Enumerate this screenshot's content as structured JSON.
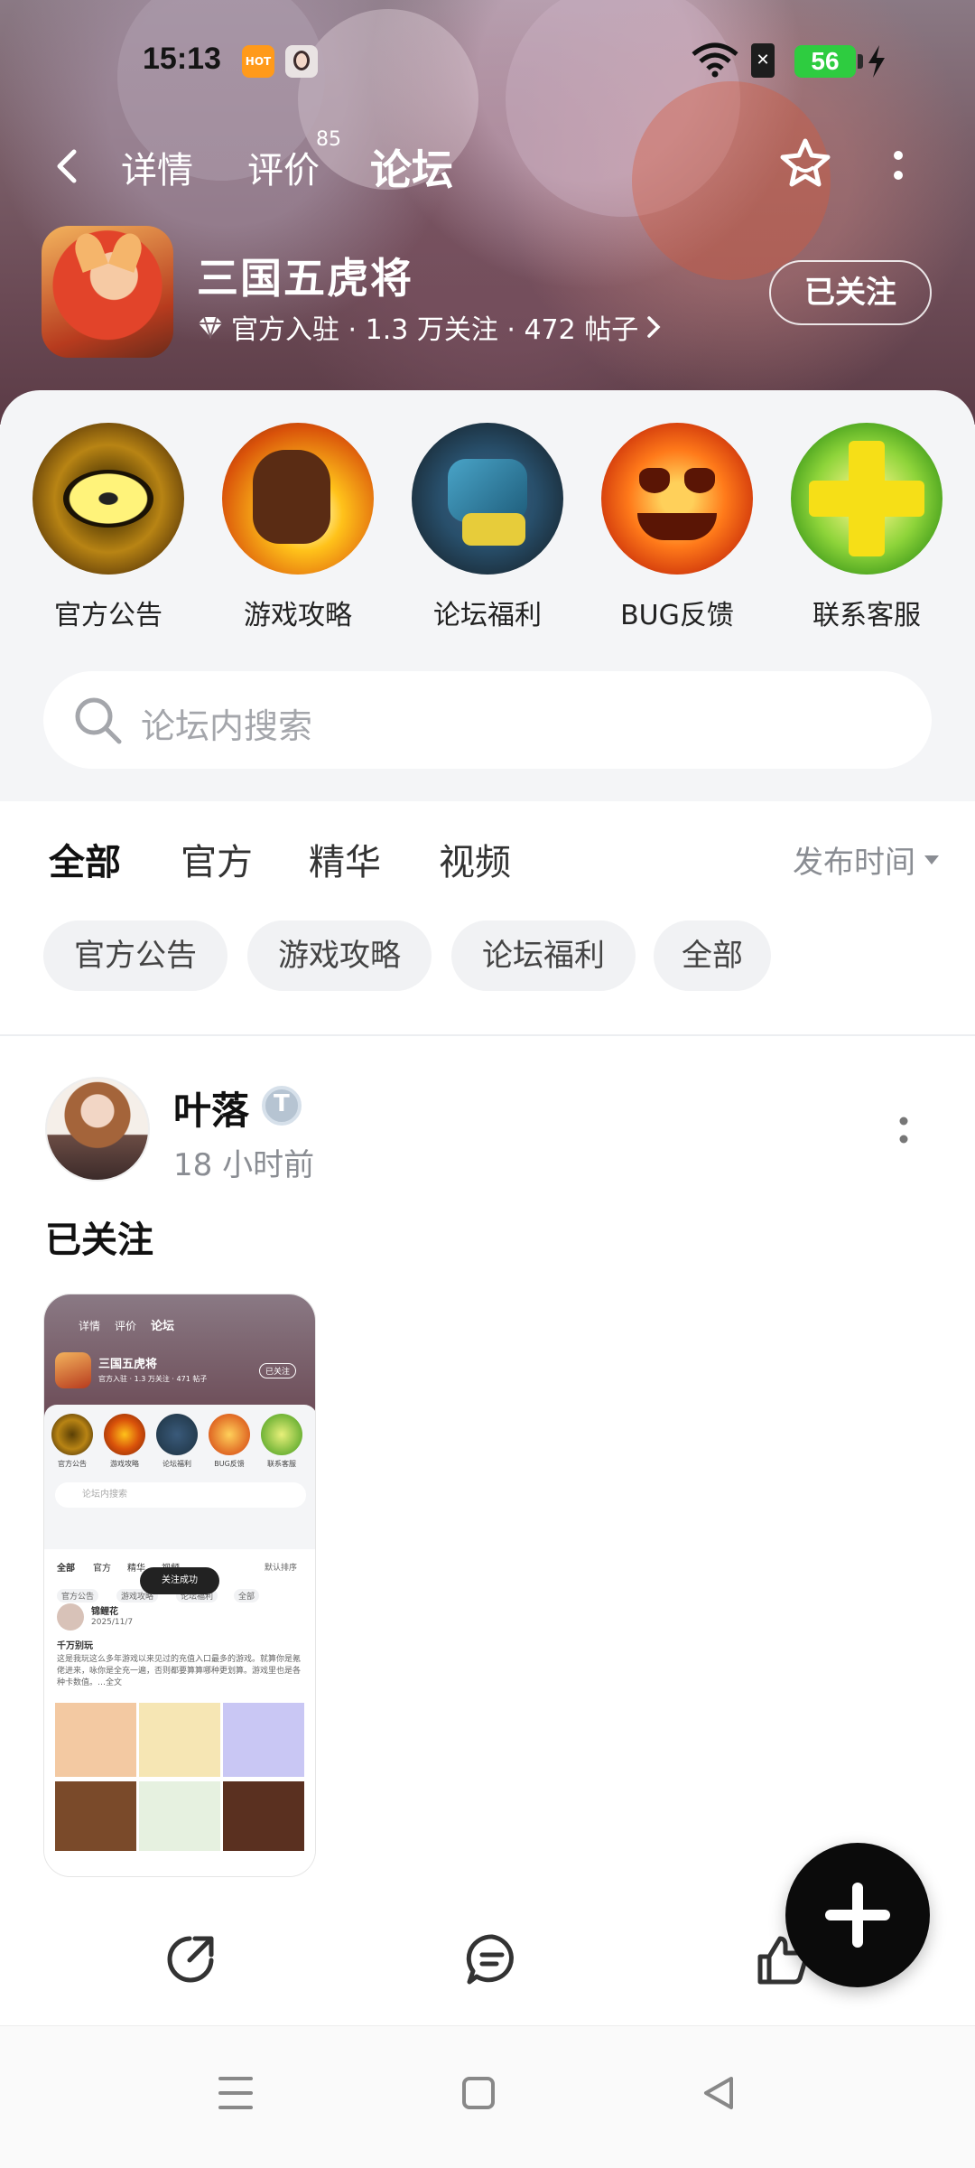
{
  "status_bar": {
    "time": "15:13",
    "app_badge": "HOT",
    "battery": "56",
    "accent_battery": "#2ecc40"
  },
  "nav": {
    "tabs": [
      {
        "label": "详情"
      },
      {
        "label": "评价",
        "badge": "85"
      },
      {
        "label": "论坛",
        "active": true
      }
    ],
    "icons": [
      "back-icon",
      "star-icon",
      "more-icon"
    ]
  },
  "game": {
    "name": "三国五虎将",
    "meta": "官方入驻 · 1.3 万关注 · 472 帖子",
    "follow_label": "已关注"
  },
  "categories": [
    {
      "label": "官方公告"
    },
    {
      "label": "游戏攻略"
    },
    {
      "label": "论坛福利"
    },
    {
      "label": "BUG反馈"
    },
    {
      "label": "联系客服"
    }
  ],
  "search": {
    "placeholder": "论坛内搜索"
  },
  "filter_tabs": {
    "items": [
      "全部",
      "官方",
      "精华",
      "视频"
    ],
    "active": "全部",
    "sort_label": "发布时间",
    "accent": "#19d7c2"
  },
  "chips": [
    "官方公告",
    "游戏攻略",
    "论坛福利",
    "全部"
  ],
  "post": {
    "author": "叶落",
    "time": "18 小时前",
    "title": "已关注",
    "image_text": {
      "tabs": [
        "详情",
        "评价",
        "论坛"
      ],
      "game_name": "三国五虎将",
      "meta": "官方入驻 · 1.3 万关注 · 471 帖子",
      "follow": "已关注",
      "cats": [
        "官方公告",
        "游戏攻略",
        "论坛福利",
        "BUG反馈",
        "联系客服"
      ],
      "search": "论坛内搜索",
      "ftabs": [
        "全部",
        "官方",
        "精华",
        "视频"
      ],
      "sort": "默认排序",
      "chips": [
        "官方公告",
        "游戏攻略",
        "论坛福利",
        "全部"
      ],
      "toast": "关注成功",
      "author": "锦鲤花",
      "date": "2025/11/7",
      "post_title": "千万别玩",
      "body": "这是我玩这么多年游戏以来见过的充值入口最多的游戏。就算你是氪佬进来，咏你是全充一遍，否则都要算算哪种更划算。游戏里也是各种卡数值。…全文"
    }
  }
}
